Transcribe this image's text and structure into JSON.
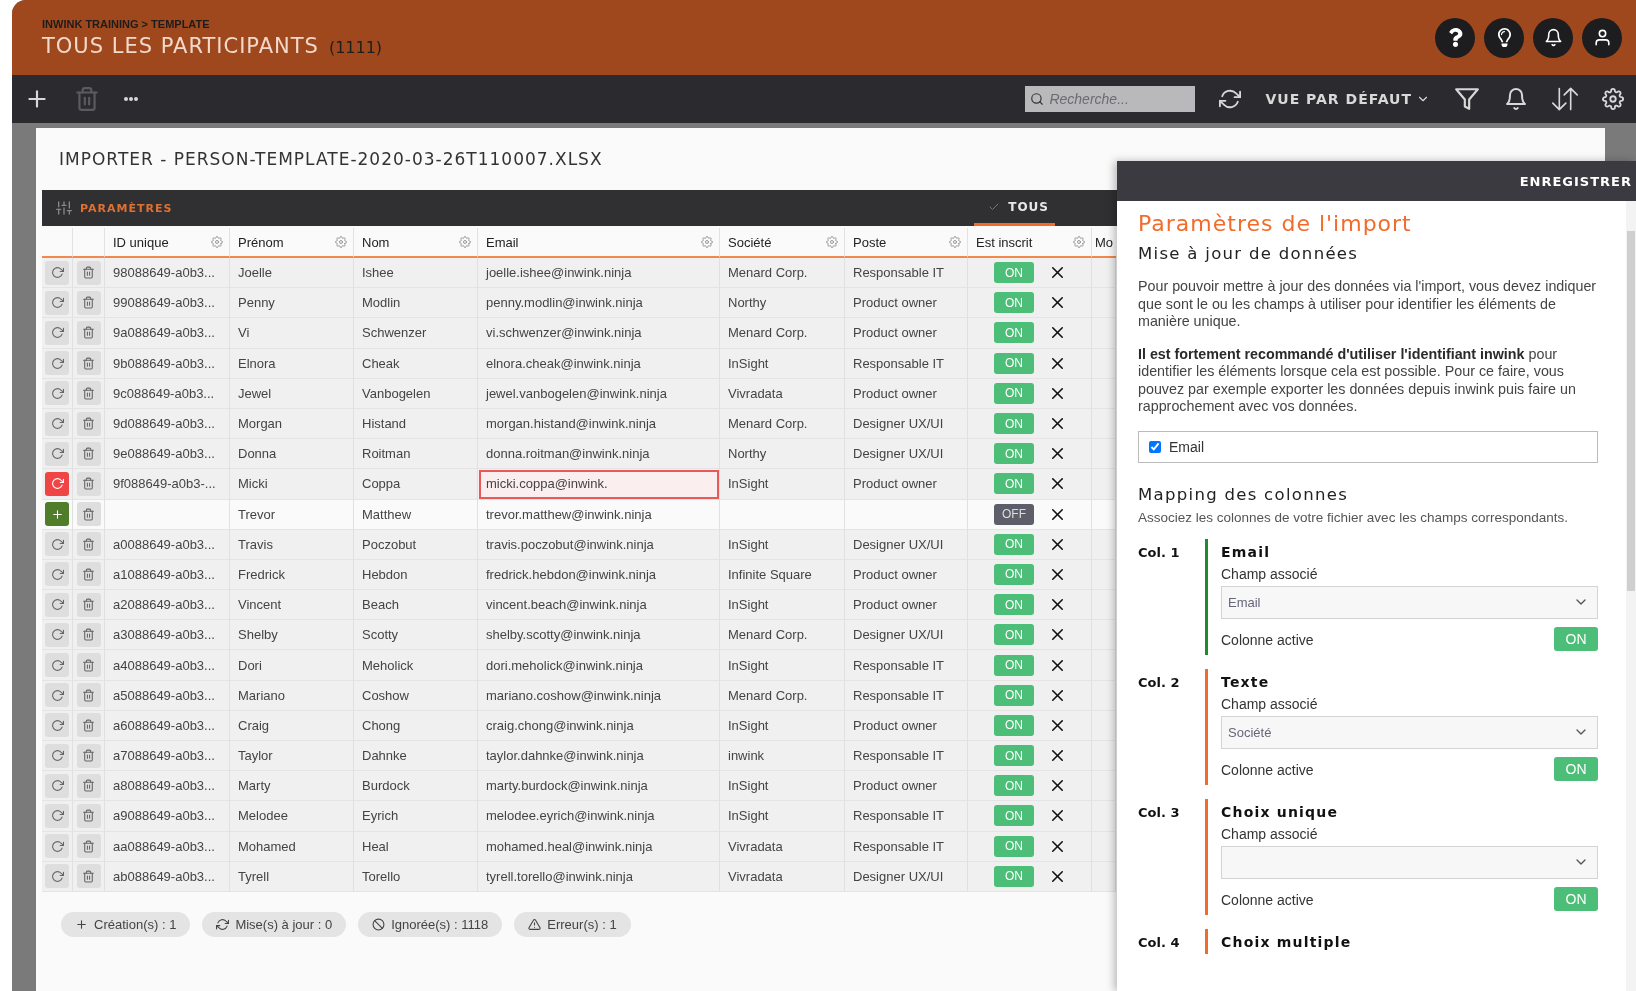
{
  "header": {
    "breadcrumb": "INWINK TRAINING > TEMPLATE",
    "title": "TOUS LES PARTICIPANTS",
    "count": "(1111)"
  },
  "toolbar": {
    "search": {
      "placeholder": "Recherche..."
    },
    "view": "VUE PAR DÉFAUT"
  },
  "modal": {
    "title": "IMPORTER - PERSON-TEMPLATE-2020-03-26T110007.XLSX",
    "settings_label": "PARAMÈTRES",
    "filter_tab": {
      "label": "TOUS",
      "selected": true
    },
    "columns": [
      "ID unique",
      "Prénom",
      "Nom",
      "Email",
      "Société",
      "Poste",
      "Est inscrit",
      "Mo"
    ],
    "rows": [
      {
        "kind": "ignored",
        "id": "98088649-a0b3...",
        "first": "Joelle",
        "last": "Ishee",
        "email": "joelle.ishee@inwink.ninja",
        "company": "Menard Corp.",
        "job": "Responsable IT",
        "registered": {
          "label": "ON",
          "on": true
        }
      },
      {
        "kind": "ignored",
        "id": "99088649-a0b3...",
        "first": "Penny",
        "last": "Modlin",
        "email": "penny.modlin@inwink.ninja",
        "company": "Northy",
        "job": "Product owner",
        "registered": {
          "label": "ON",
          "on": true
        }
      },
      {
        "kind": "ignored",
        "id": "9a088649-a0b3...",
        "first": "Vi",
        "last": "Schwenzer",
        "email": "vi.schwenzer@inwink.ninja",
        "company": "Menard Corp.",
        "job": "Product owner",
        "registered": {
          "label": "ON",
          "on": true
        }
      },
      {
        "kind": "ignored",
        "id": "9b088649-a0b3...",
        "first": "Elnora",
        "last": "Cheak",
        "email": "elnora.cheak@inwink.ninja",
        "company": "InSight",
        "job": "Responsable IT",
        "registered": {
          "label": "ON",
          "on": true
        }
      },
      {
        "kind": "ignored",
        "id": "9c088649-a0b3...",
        "first": "Jewel",
        "last": "Vanbogelen",
        "email": "jewel.vanbogelen@inwink.ninja",
        "company": "Vivradata",
        "job": "Product owner",
        "registered": {
          "label": "ON",
          "on": true
        }
      },
      {
        "kind": "ignored",
        "id": "9d088649-a0b3...",
        "first": "Morgan",
        "last": "Histand",
        "email": "morgan.histand@inwink.ninja",
        "company": "Menard Corp.",
        "job": "Designer UX/UI",
        "registered": {
          "label": "ON",
          "on": true
        }
      },
      {
        "kind": "ignored",
        "id": "9e088649-a0b3...",
        "first": "Donna",
        "last": "Roitman",
        "email": "donna.roitman@inwink.ninja",
        "company": "Northy",
        "job": "Designer UX/UI",
        "registered": {
          "label": "ON",
          "on": true
        }
      },
      {
        "kind": "error",
        "id": "9f088649-a0b3-...",
        "first": "Micki",
        "last": "Coppa",
        "email": "micki.coppa@inwink.",
        "company": "InSight",
        "job": "Product owner",
        "registered": {
          "label": "ON",
          "on": true
        }
      },
      {
        "kind": "create",
        "first": "Trevor",
        "last": "Matthew",
        "email": "trevor.matthew@inwink.ninja",
        "registered": {
          "label": "OFF",
          "on": false
        }
      },
      {
        "kind": "ignored",
        "id": "a0088649-a0b3...",
        "first": "Travis",
        "last": "Poczobut",
        "email": "travis.poczobut@inwink.ninja",
        "company": "InSight",
        "job": "Designer UX/UI",
        "registered": {
          "label": "ON",
          "on": true
        }
      },
      {
        "kind": "ignored",
        "id": "a1088649-a0b3...",
        "first": "Fredrick",
        "last": "Hebdon",
        "email": "fredrick.hebdon@inwink.ninja",
        "company": "Infinite Square",
        "job": "Product owner",
        "registered": {
          "label": "ON",
          "on": true
        }
      },
      {
        "kind": "ignored",
        "id": "a2088649-a0b3...",
        "first": "Vincent",
        "last": "Beach",
        "email": "vincent.beach@inwink.ninja",
        "company": "InSight",
        "job": "Product owner",
        "registered": {
          "label": "ON",
          "on": true
        }
      },
      {
        "kind": "ignored",
        "id": "a3088649-a0b3...",
        "first": "Shelby",
        "last": "Scotty",
        "email": "shelby.scotty@inwink.ninja",
        "company": "Menard Corp.",
        "job": "Designer UX/UI",
        "registered": {
          "label": "ON",
          "on": true
        }
      },
      {
        "kind": "ignored",
        "id": "a4088649-a0b3...",
        "first": "Dori",
        "last": "Meholick",
        "email": "dori.meholick@inwink.ninja",
        "company": "InSight",
        "job": "Responsable IT",
        "registered": {
          "label": "ON",
          "on": true
        }
      },
      {
        "kind": "ignored",
        "id": "a5088649-a0b3...",
        "first": "Mariano",
        "last": "Coshow",
        "email": "mariano.coshow@inwink.ninja",
        "company": "Menard Corp.",
        "job": "Responsable IT",
        "registered": {
          "label": "ON",
          "on": true
        }
      },
      {
        "kind": "ignored",
        "id": "a6088649-a0b3...",
        "first": "Craig",
        "last": "Chong",
        "email": "craig.chong@inwink.ninja",
        "company": "InSight",
        "job": "Product owner",
        "registered": {
          "label": "ON",
          "on": true
        }
      },
      {
        "kind": "ignored",
        "id": "a7088649-a0b3...",
        "first": "Taylor",
        "last": "Dahnke",
        "email": "taylor.dahnke@inwink.ninja",
        "company": "inwink",
        "job": "Responsable IT",
        "registered": {
          "label": "ON",
          "on": true
        }
      },
      {
        "kind": "ignored",
        "id": "a8088649-a0b3...",
        "first": "Marty",
        "last": "Burdock",
        "email": "marty.burdock@inwink.ninja",
        "company": "InSight",
        "job": "Product owner",
        "registered": {
          "label": "ON",
          "on": true
        }
      },
      {
        "kind": "ignored",
        "id": "a9088649-a0b3...",
        "first": "Melodee",
        "last": "Eyrich",
        "email": "melodee.eyrich@inwink.ninja",
        "company": "InSight",
        "job": "Responsable IT",
        "registered": {
          "label": "ON",
          "on": true
        }
      },
      {
        "kind": "ignored",
        "id": "aa088649-a0b3...",
        "first": "Mohamed",
        "last": "Heal",
        "email": "mohamed.heal@inwink.ninja",
        "company": "Vivradata",
        "job": "Responsable IT",
        "registered": {
          "label": "ON",
          "on": true
        }
      },
      {
        "kind": "ignored",
        "id": "ab088649-a0b3...",
        "first": "Tyrell",
        "last": "Torello",
        "email": "tyrell.torello@inwink.ninja",
        "company": "Vivradata",
        "job": "Designer UX/UI",
        "registered": {
          "label": "ON",
          "on": true
        }
      }
    ],
    "summary": [
      {
        "kind": "create",
        "label": "Création(s) : 1"
      },
      {
        "kind": "update",
        "label": "Mise(s) à jour : 0"
      },
      {
        "kind": "ignored",
        "label": "Ignorée(s) : 1118"
      },
      {
        "kind": "error",
        "label": "Erreur(s) : 1"
      }
    ]
  },
  "panel": {
    "save": "ENREGISTRER",
    "title": "Paramètres de l'import",
    "update_heading": "Mise à jour de données",
    "paragraphs": [
      "Pour pouvoir mettre à jour des données via l'import, vous devez indiquer que sont le ou les champs à utiliser pour identifier les éléments de manière unique.",
      "**Il est fortement recommandé d'utiliser l'identifiant inwink** pour identifier les éléments lorsque cela est possible. Pour ce faire, vous pouvez par exemple exporter les données depuis inwink puis faire un rapprochement avec vos données."
    ],
    "key_fields": [
      {
        "label": "Email",
        "checked": true
      }
    ],
    "mapping_heading": "Mapping des colonnes",
    "mapping_hint": "Associez les colonnes de votre fichier avec les champs correspondants.",
    "mappings": [
      {
        "col": "Col. 1",
        "type": "Email",
        "color": "#1f8a2e",
        "field_label": "Champ associé",
        "value": "Email",
        "active_label": "Colonne active",
        "active": {
          "label": "ON",
          "on": true
        }
      },
      {
        "col": "Col. 2",
        "type": "Texte",
        "color": "#f26b2a",
        "field_label": "Champ associé",
        "value": "Société",
        "active_label": "Colonne active",
        "active": {
          "label": "ON",
          "on": true
        }
      },
      {
        "col": "Col. 3",
        "type": "Choix unique",
        "color": "#f26b2a",
        "field_label": "Champ associé",
        "active_label": "Colonne active",
        "active": {
          "label": "ON",
          "on": true
        }
      },
      {
        "col": "Col. 4",
        "type": "Choix multiple",
        "color": "#f26b2a"
      }
    ]
  }
}
